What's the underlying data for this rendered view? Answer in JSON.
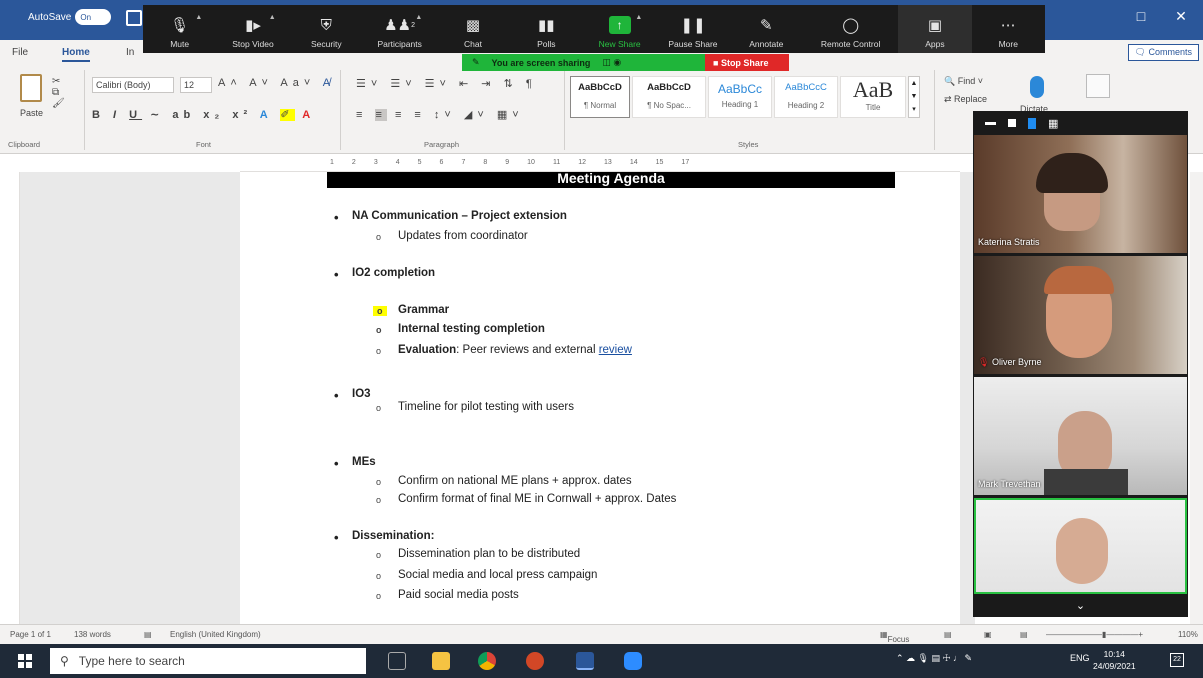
{
  "word": {
    "autosave_label": "AutoSave",
    "autosave_toggle": "On",
    "tabs": [
      "File",
      "Home",
      "In"
    ],
    "comments_label": "Comments"
  },
  "zoom": {
    "controls": [
      {
        "label": "Mute",
        "icon": "microphone-icon"
      },
      {
        "label": "Stop Video",
        "icon": "video-camera-icon"
      },
      {
        "label": "Security",
        "icon": "shield-icon"
      },
      {
        "label": "Participants",
        "icon": "people-icon",
        "count": "2"
      },
      {
        "label": "Chat",
        "icon": "chat-icon"
      },
      {
        "label": "Polls",
        "icon": "polls-icon"
      },
      {
        "label": "New Share",
        "icon": "share-screen-icon"
      },
      {
        "label": "Pause Share",
        "icon": "pause-icon"
      },
      {
        "label": "Annotate",
        "icon": "pen-icon"
      },
      {
        "label": "Remote Control",
        "icon": "mouse-icon"
      },
      {
        "label": "Apps",
        "icon": "apps-icon"
      },
      {
        "label": "More",
        "icon": "more-icon"
      }
    ],
    "sharing_text": "You are screen sharing",
    "stop_share": "Stop Share",
    "green": "#1fb53a",
    "red": "#e02828"
  },
  "ribbon": {
    "paste": "Paste",
    "font_name": "Calibri (Body)",
    "font_size": "12",
    "clipboard": "Clipboard",
    "font": "Font",
    "paragraph": "Paragraph",
    "styles_label": "Styles",
    "styles": [
      {
        "sample": "AaBbCcD",
        "name": "¶ Normal"
      },
      {
        "sample": "AaBbCcD",
        "name": "¶ No Spac..."
      },
      {
        "sample": "AaBbCc",
        "name": "Heading 1"
      },
      {
        "sample": "AaBbCcC",
        "name": "Heading 2"
      },
      {
        "sample": "AaB",
        "name": "Title"
      }
    ],
    "find": "Find",
    "replace": "Replace",
    "dictate": "Dictate"
  },
  "document": {
    "heading": "Meeting Agenda",
    "items": [
      {
        "text": "NA Communication – Project extension",
        "subs": [
          "Updates from coordinator"
        ]
      },
      {
        "text": "IO2 completion"
      },
      {
        "text": "IO3",
        "subs": [
          "Timeline for pilot testing with users"
        ]
      },
      {
        "text": "MEs",
        "subs": [
          "Confirm on national ME plans + approx. dates",
          "Confirm format of final ME in Cornwall + approx. Dates"
        ]
      },
      {
        "text": "Dissemination:",
        "subs": [
          "Dissemination plan to be distributed",
          "Social media and local press campaign",
          "Paid social media posts"
        ]
      }
    ],
    "io2_subs": {
      "grammar": "Grammar",
      "internal": "Internal testing completion",
      "evaluation_label": "Evaluation",
      "evaluation_rest": ": Peer reviews and external ",
      "evaluation_link": "review"
    }
  },
  "participants": [
    {
      "name": "Katerina Stratis"
    },
    {
      "name": "Oliver Byrne"
    },
    {
      "name": "Mark Trevethan"
    },
    {
      "name": ""
    }
  ],
  "status": {
    "page": "Page 1 of 1",
    "words": "138 words",
    "language": "English (United Kingdom)",
    "focus": "Focus",
    "zoom": "110%"
  },
  "taskbar": {
    "search_placeholder": "Type here to search",
    "lang": "ENG",
    "time": "10:14",
    "date": "24/09/2021",
    "notifications": "22"
  }
}
